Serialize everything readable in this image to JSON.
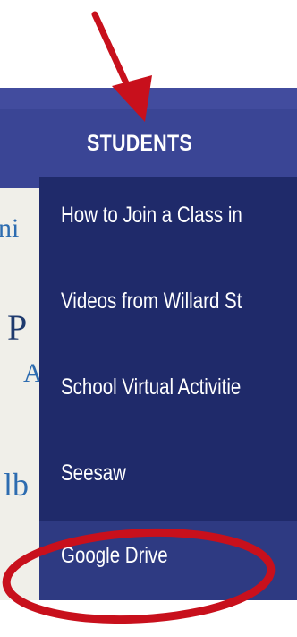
{
  "nav": {
    "title": "STUDENTS"
  },
  "background_fragments": [
    "ni",
    "P",
    "A",
    "lb"
  ],
  "menu": {
    "items": [
      {
        "label": "How to Join a Class in"
      },
      {
        "label": "Videos from Willard St"
      },
      {
        "label": "School Virtual Activitie"
      },
      {
        "label": "Seesaw"
      },
      {
        "label": "Google Drive"
      }
    ]
  },
  "colors": {
    "nav_bg": "#3a4595",
    "menu_bg": "#1f2a6a",
    "highlight_bg": "#2e3a82",
    "annotation_red": "#c8101c"
  }
}
